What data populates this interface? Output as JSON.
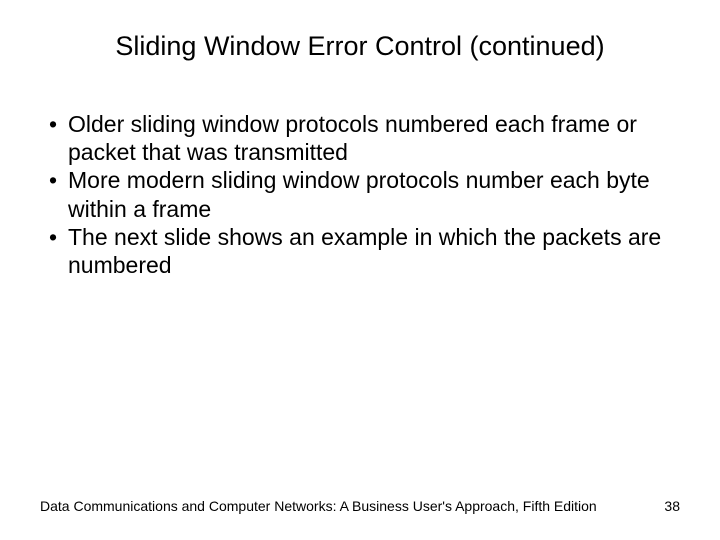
{
  "title": "Sliding Window Error Control (continued)",
  "bullets": [
    "Older sliding window protocols numbered each frame or packet that was transmitted",
    "More modern sliding window protocols number each byte within a frame",
    "The next slide shows an example in which the packets are numbered"
  ],
  "footer": {
    "text": "Data Communications and Computer Networks: A Business User's Approach, Fifth Edition",
    "page": "38"
  }
}
